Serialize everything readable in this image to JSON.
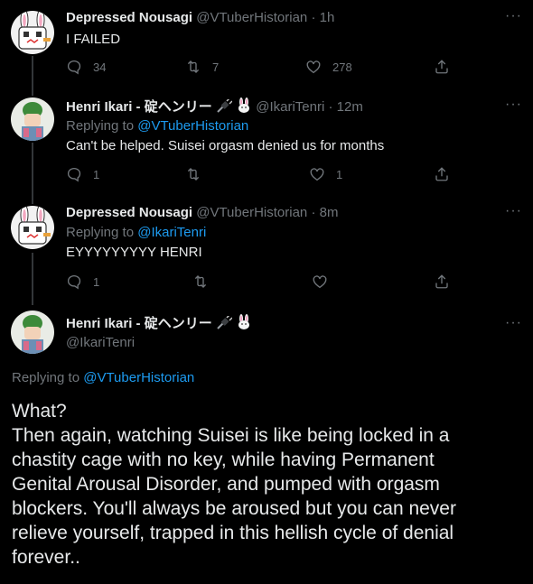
{
  "tweets": [
    {
      "name": "Depressed Nousagi",
      "handle": "@VTuberHistorian",
      "dot": "·",
      "time": "1h",
      "text": "I FAILED",
      "replies": "34",
      "retweets": "7",
      "likes": "278"
    },
    {
      "name": "Henri Ikari - 碇ヘンリー",
      "handle": "@IkariTenri",
      "dot": "·",
      "time": "12m",
      "replying_label": "Replying to",
      "replying_to": "@VTuberHistorian",
      "text": "Can't be helped. Suisei orgasm denied us for months",
      "replies": "1",
      "retweets": "",
      "likes": "1"
    },
    {
      "name": "Depressed Nousagi",
      "handle": "@VTuberHistorian",
      "dot": "·",
      "time": "8m",
      "replying_label": "Replying to",
      "replying_to": "@IkariTenri",
      "text": "EYYYYYYYYY HENRI",
      "replies": "1",
      "retweets": "",
      "likes": ""
    }
  ],
  "main_tweet": {
    "name": "Henri Ikari - 碇ヘンリー",
    "handle": "@IkariTenri",
    "replying_label": "Replying to",
    "replying_to": "@VTuberHistorian",
    "text_lines": [
      "What?",
      "Then again, watching Suisei is like being locked in a",
      "chastity cage with no key, while having Permanent",
      "Genital Arousal Disorder, and pumped with orgasm",
      "blockers. You'll always be aroused but you can never",
      "relieve yourself, trapped in this hellish cycle of denial",
      "forever.."
    ]
  },
  "icons": {
    "reply": "reply-icon",
    "retweet": "retweet-icon",
    "like": "heart-icon",
    "share": "share-icon",
    "more": "more-icon",
    "plug": "plug-emoji-icon",
    "rabbit": "rabbit-emoji-icon"
  },
  "colors": {
    "background": "#000000",
    "text": "#e7e9ea",
    "muted": "#71767b",
    "link": "#1d9bf0",
    "thread_line": "#333639"
  }
}
